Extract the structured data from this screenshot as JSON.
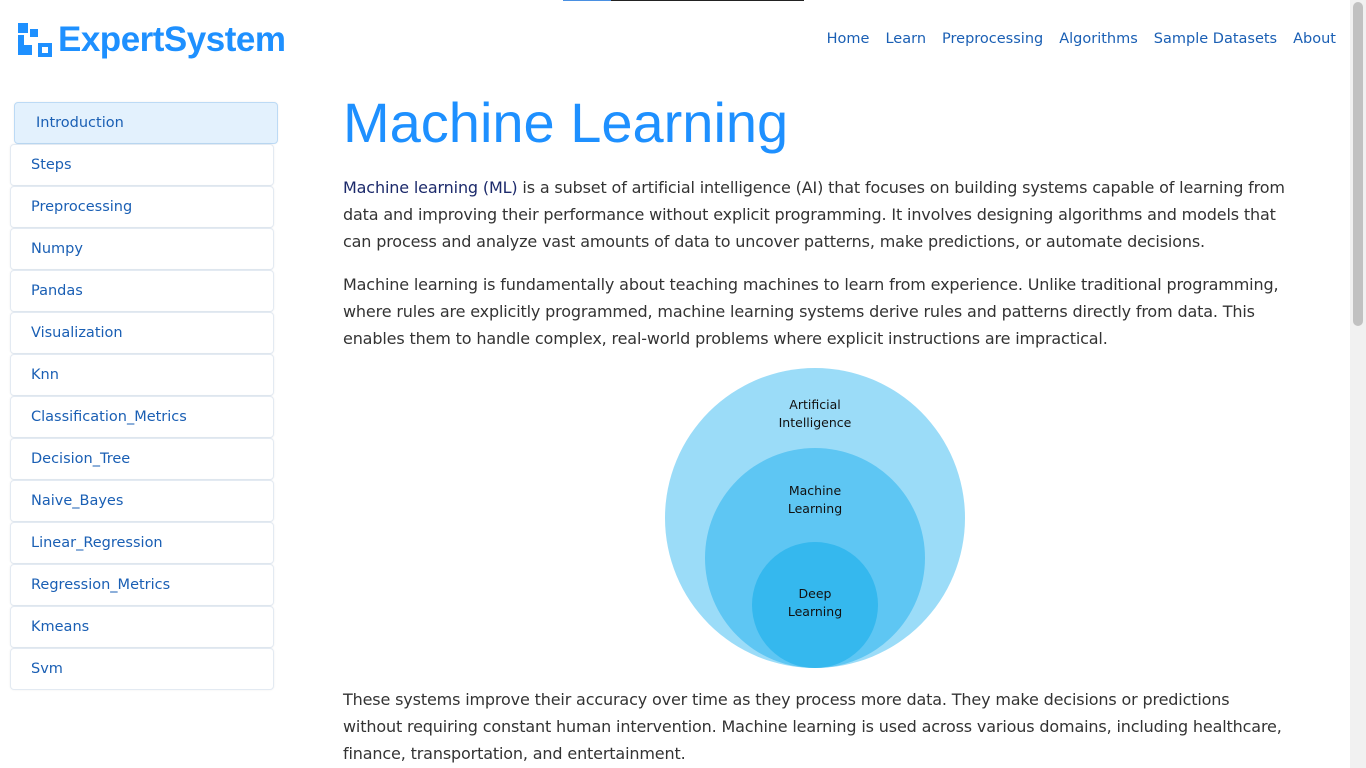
{
  "logo": {
    "text": "ExpertSystem",
    "icon": "expertsystem-logo-icon"
  },
  "top_progress": {
    "percent": 20
  },
  "nav": {
    "items": [
      {
        "label": "Home"
      },
      {
        "label": "Learn"
      },
      {
        "label": "Preprocessing"
      },
      {
        "label": "Algorithms"
      },
      {
        "label": "Sample Datasets"
      },
      {
        "label": "About"
      }
    ]
  },
  "sidebar": {
    "items": [
      {
        "label": "Introduction",
        "active": true
      },
      {
        "label": "Steps"
      },
      {
        "label": "Preprocessing"
      },
      {
        "label": "Numpy"
      },
      {
        "label": "Pandas"
      },
      {
        "label": "Visualization"
      },
      {
        "label": "Knn"
      },
      {
        "label": "Classification_Metrics"
      },
      {
        "label": "Decision_Tree"
      },
      {
        "label": "Naive_Bayes"
      },
      {
        "label": "Linear_Regression"
      },
      {
        "label": "Regression_Metrics"
      },
      {
        "label": "Kmeans"
      },
      {
        "label": "Svm"
      }
    ]
  },
  "main": {
    "title": "Machine Learning",
    "para1_strong": "Machine learning (ML)",
    "para1_rest": " is a subset of artificial intelligence (AI) that focuses on building systems capable of learning from data and improving their performance without explicit programming. It involves designing algorithms and models that can process and analyze vast amounts of data to uncover patterns, make predictions, or automate decisions.",
    "para2": "Machine learning is fundamentally about teaching machines to learn from experience. Unlike traditional programming, where rules are explicitly programmed, machine learning systems derive rules and patterns directly from data. This enables them to handle complex, real-world problems where explicit instructions are impractical.",
    "figure": {
      "outer": "Artificial\nIntelligence",
      "middle": "Machine\nLearning",
      "inner": "Deep\nLearning",
      "colors": {
        "outer": "#9bdcf8",
        "middle": "#5ec6f3",
        "inner": "#35b8ee"
      }
    },
    "para3": "These systems improve their accuracy over time as they process more data. They make decisions or predictions without requiring constant human intervention. Machine learning is used across various domains, including healthcare, finance, transportation, and entertainment."
  }
}
